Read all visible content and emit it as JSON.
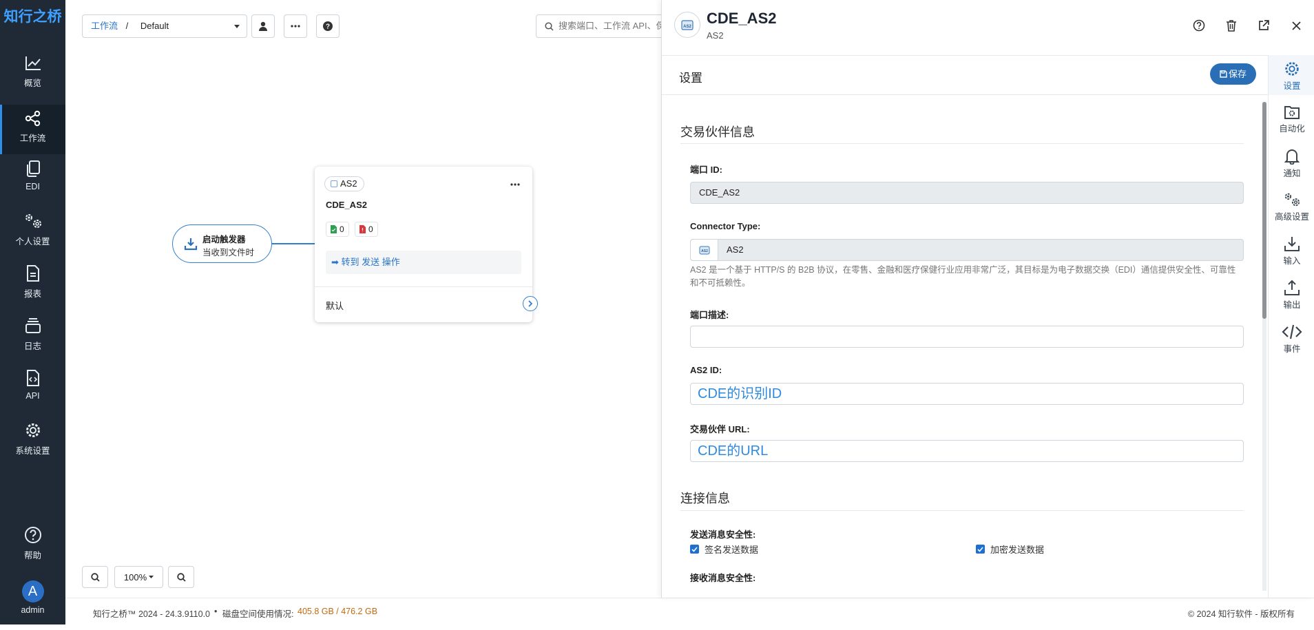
{
  "nav": {
    "logo": "知行之桥",
    "items": [
      {
        "label": "概览",
        "icon": "chart-line-icon"
      },
      {
        "label": "工作流",
        "icon": "workflow-icon"
      },
      {
        "label": "EDI",
        "icon": "copy-icon"
      },
      {
        "label": "个人设置",
        "icon": "gears-icon"
      },
      {
        "label": "报表",
        "icon": "file-icon"
      },
      {
        "label": "日志",
        "icon": "stack-icon"
      },
      {
        "label": "API",
        "icon": "file-code-icon"
      },
      {
        "label": "系统设置",
        "icon": "gear-icon"
      },
      {
        "label": "帮助",
        "icon": "help-circle-icon"
      }
    ],
    "active_item": "工作流",
    "user": {
      "initial": "A",
      "name": "admin"
    }
  },
  "toolbar": {
    "breadcrumb_root": "工作流",
    "breadcrumb_sep": "/",
    "workspace": "Default",
    "search_placeholder": "搜索端口、工作流 API、保存的任务"
  },
  "flow": {
    "trigger": {
      "title": "启动触发器",
      "subtitle": "当收到文件时"
    },
    "card": {
      "type": "AS2",
      "name": "CDE_AS2",
      "success_count": "0",
      "error_count": "0",
      "action": "转到 发送 操作",
      "footer": "默认"
    },
    "zoom": "100%"
  },
  "footer": {
    "product": "知行之桥™ 2024 - 24.3.9110.0",
    "bullet": "•",
    "disk_label": "磁盘空间使用情况:",
    "disk_value": "405.8 GB / 476.2 GB",
    "copyright": "© 2024 知行软件 - 版权所有"
  },
  "panel": {
    "title": "CDE_AS2",
    "subtitle": "AS2",
    "section": "设置",
    "save_label": "保存",
    "partner_heading": "交易伙伴信息",
    "port_id_label": "端口 ID:",
    "port_id_value": "CDE_AS2",
    "connector_type_label": "Connector Type:",
    "connector_type_value": "AS2",
    "connector_help": "AS2 是一个基于 HTTP/S 的 B2B 协议，在零售、金融和医疗保健行业应用非常广泛，其目标是为电子数据交换（EDI）通信提供安全性、可靠性和不可抵赖性。",
    "description_label": "端口描述:",
    "description_value": "",
    "as2_id_label": "AS2 ID:",
    "as2_id_value": "CDE的识别ID",
    "partner_url_label": "交易伙伴 URL:",
    "partner_url_value": "CDE的URL",
    "connection_heading": "连接信息",
    "send_security_label": "发送消息安全性:",
    "sign_label": "签名发送数据",
    "encrypt_label": "加密发送数据",
    "receive_security_label": "接收消息安全性:"
  },
  "rail": [
    {
      "label": "设置",
      "icon": "gear-icon"
    },
    {
      "label": "自动化",
      "icon": "folder-gear-icon"
    },
    {
      "label": "通知",
      "icon": "bell-icon"
    },
    {
      "label": "高级设置",
      "icon": "gears-icon"
    },
    {
      "label": "输入",
      "icon": "download-icon"
    },
    {
      "label": "输出",
      "icon": "upload-icon"
    },
    {
      "label": "事件",
      "icon": "code-icon"
    }
  ]
}
